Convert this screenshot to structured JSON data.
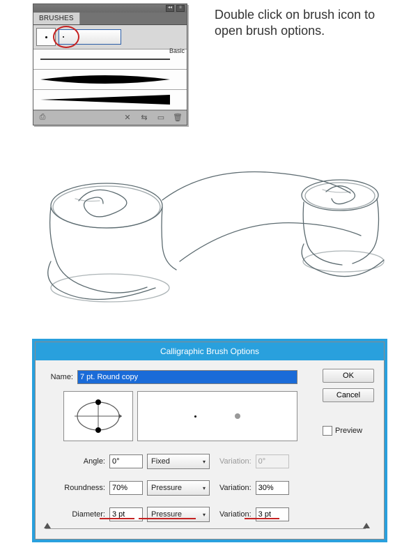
{
  "instruction": "Double click on brush icon to open brush options.",
  "panel": {
    "tab": "BRUSHES",
    "list_label": "Basic",
    "header_buttons": {
      "collapse": "◂◂",
      "menu": "≡"
    },
    "footer_icons": {
      "lib": "⎙",
      "x": "✕",
      "chain": "⇆",
      "new": "▭",
      "trash": "🗑"
    }
  },
  "dialog": {
    "title": "Calligraphic Brush Options",
    "name_label": "Name:",
    "name_value": "7 pt. Round copy",
    "ok": "OK",
    "cancel": "Cancel",
    "preview": "Preview",
    "angle": {
      "label": "Angle:",
      "value": "0°",
      "mode": "Fixed",
      "var_label": "Variation:",
      "var_value": "0°"
    },
    "roundness": {
      "label": "Roundness:",
      "value": "70%",
      "mode": "Pressure",
      "var_label": "Variation:",
      "var_value": "30%"
    },
    "diameter": {
      "label": "Diameter:",
      "value": "3 pt",
      "mode": "Pressure",
      "var_label": "Variation:",
      "var_value": "3 pt"
    }
  }
}
